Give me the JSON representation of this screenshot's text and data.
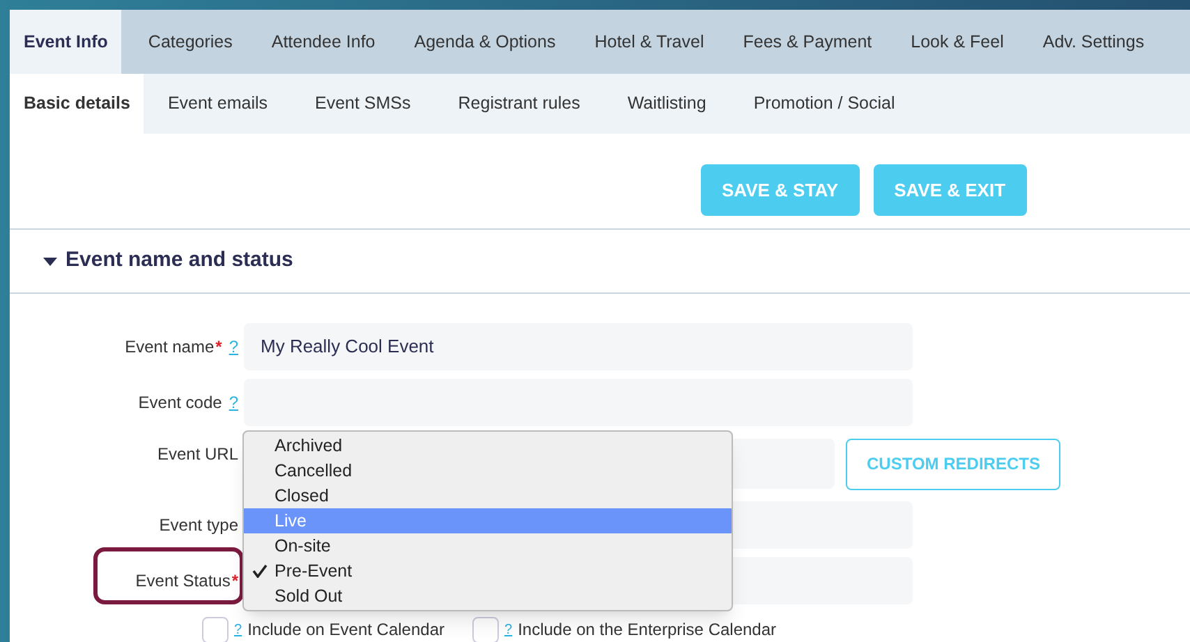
{
  "main_tabs": [
    {
      "label": "Event Info",
      "selected": true
    },
    {
      "label": "Categories",
      "selected": false
    },
    {
      "label": "Attendee Info",
      "selected": false
    },
    {
      "label": "Agenda & Options",
      "selected": false
    },
    {
      "label": "Hotel & Travel",
      "selected": false
    },
    {
      "label": "Fees & Payment",
      "selected": false
    },
    {
      "label": "Look & Feel",
      "selected": false
    },
    {
      "label": "Adv. Settings",
      "selected": false
    }
  ],
  "sub_tabs": [
    {
      "label": "Basic details",
      "selected": true
    },
    {
      "label": "Event emails",
      "selected": false
    },
    {
      "label": "Event SMSs",
      "selected": false
    },
    {
      "label": "Registrant rules",
      "selected": false
    },
    {
      "label": "Waitlisting",
      "selected": false
    },
    {
      "label": "Promotion / Social",
      "selected": false
    }
  ],
  "buttons": [
    "SAVE & STAY",
    "SAVE & EXIT"
  ],
  "section": {
    "title": "Event name and status",
    "expanded": true
  },
  "fields": [
    {
      "label": "Event name",
      "required_mark": "*",
      "help": "?",
      "value": "My Really Cool Event"
    },
    {
      "label": "Event code",
      "help": "?"
    },
    {
      "label": "Event URL",
      "button": "CUSTOM REDIRECTS"
    },
    {
      "label": "Event type"
    },
    {
      "label": "Event Status",
      "required_mark": "*",
      "highlighted_outline": true
    }
  ],
  "status_menu": [
    {
      "label": "Archived",
      "selected": false,
      "highlighted": false
    },
    {
      "label": "Cancelled",
      "selected": false,
      "highlighted": false
    },
    {
      "label": "Closed",
      "selected": false,
      "highlighted": false
    },
    {
      "label": "Live",
      "selected": false,
      "highlighted": true
    },
    {
      "label": "On-site",
      "selected": false,
      "highlighted": false
    },
    {
      "label": "Pre-Event",
      "selected": true,
      "highlighted": false
    },
    {
      "label": "Sold Out",
      "selected": false,
      "highlighted": false
    }
  ],
  "checkboxes": [
    {
      "label": "Include on Event Calendar",
      "help": "?",
      "checked": false
    },
    {
      "label": "Include on the Enterprise Calendar",
      "help": "?",
      "checked": false
    }
  ]
}
